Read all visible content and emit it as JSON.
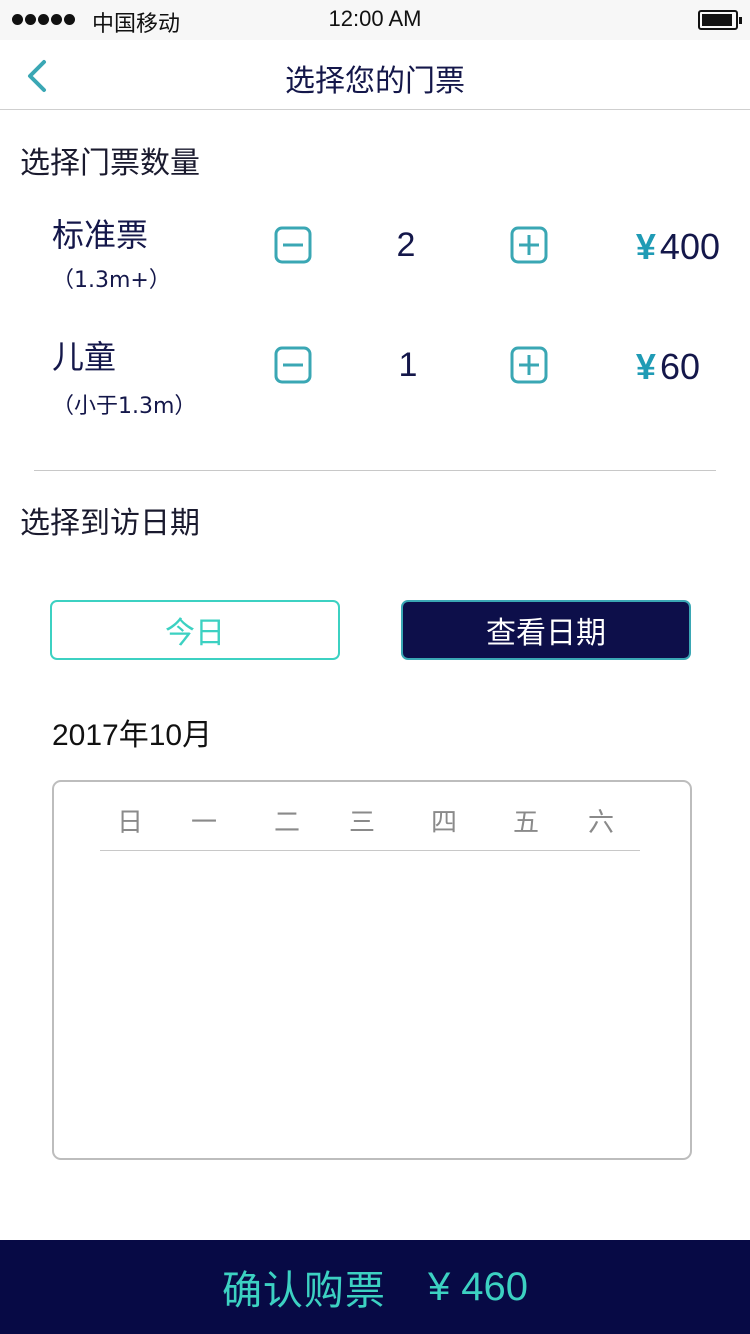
{
  "status_bar": {
    "carrier": "中国移动",
    "time": "12:00 AM"
  },
  "nav": {
    "title": "选择您的门票",
    "back_icon": "chevron-left-icon"
  },
  "ticket_section": {
    "title": "选择门票数量",
    "tickets": [
      {
        "name": "标准票",
        "note": "（1.3m+）",
        "quantity": "2",
        "currency": "¥",
        "price": "400"
      },
      {
        "name": "儿童",
        "note": "（小于1.3m）",
        "quantity": "1",
        "currency": "¥",
        "price": "60"
      }
    ],
    "minus_icon": "minus-square-icon",
    "plus_icon": "plus-square-icon"
  },
  "date_section": {
    "title": "选择到访日期",
    "today_button": "今日",
    "view_dates_button": "查看日期",
    "month": "2017年10月",
    "weekdays": [
      "日",
      "一",
      "二",
      "三",
      "四",
      "五",
      "六"
    ]
  },
  "footer": {
    "confirm_label": "确认购票",
    "total": "¥ 460"
  },
  "colors": {
    "accent": "#3cd1c2",
    "navy": "#0d0f4a",
    "icon_teal": "#3aa7b4",
    "yen_blue": "#1f9bb5"
  }
}
